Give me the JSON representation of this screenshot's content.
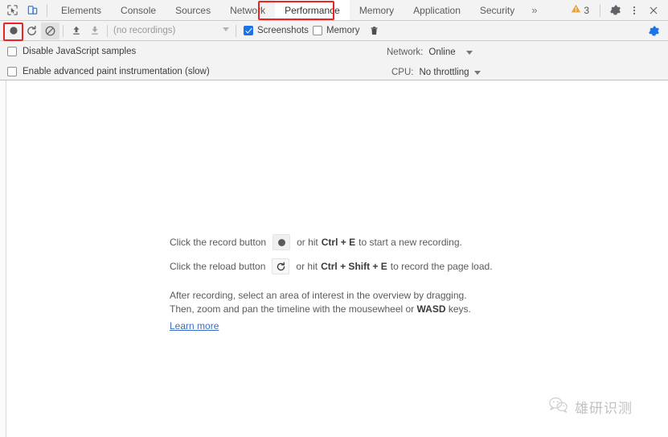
{
  "devtools": {
    "left_icons": [
      {
        "name": "inspect-element-icon",
        "title": "Inspect element"
      },
      {
        "name": "device-toolbar-icon",
        "title": "Toggle device toolbar"
      }
    ],
    "tabs": [
      {
        "label": "Elements",
        "selected": false
      },
      {
        "label": "Console",
        "selected": false
      },
      {
        "label": "Sources",
        "selected": false
      },
      {
        "label": "Network",
        "selected": false
      },
      {
        "label": "Performance",
        "selected": true
      },
      {
        "label": "Memory",
        "selected": false
      },
      {
        "label": "Application",
        "selected": false
      },
      {
        "label": "Security",
        "selected": false
      }
    ],
    "overflow_label": "»",
    "warnings": {
      "count": "3",
      "icon": "warning-triangle-icon",
      "color": "#e8a33d"
    },
    "right_icons": [
      {
        "name": "settings-gear-icon"
      },
      {
        "name": "more-options-kebab-icon"
      },
      {
        "name": "close-panel-icon"
      }
    ]
  },
  "toolbar": {
    "record_button": {
      "name": "record-button",
      "state": "idle"
    },
    "reload_button": {
      "name": "reload-and-record-button"
    },
    "clear_button": {
      "name": "clear-recording-button",
      "state": "pressed"
    },
    "load_button": {
      "name": "load-profile-icon"
    },
    "save_button": {
      "name": "save-profile-icon"
    },
    "recordings_value": "(no recordings)",
    "checkboxes": [
      {
        "label": "Screenshots",
        "checked": true,
        "name": "screenshots-checkbox"
      },
      {
        "label": "Memory",
        "checked": false,
        "name": "memory-checkbox"
      }
    ],
    "delete_button": {
      "name": "trash-icon"
    },
    "capture_settings_button": {
      "name": "capture-settings-gear-icon",
      "color": "#1a73e8"
    }
  },
  "settings": {
    "options": [
      {
        "label": "Disable JavaScript samples",
        "checked": false,
        "name": "disable-js-samples-checkbox"
      },
      {
        "label": "Enable advanced paint instrumentation (slow)",
        "checked": false,
        "name": "advanced-paint-instrumentation-checkbox"
      }
    ],
    "throttling": [
      {
        "label": "Network:",
        "value": "Online",
        "name": "network-throttling-select"
      },
      {
        "label": "CPU:",
        "value": "No throttling",
        "name": "cpu-throttling-select"
      }
    ]
  },
  "landing": {
    "line1_prefix": "Click the record button",
    "line1_mid": "or hit",
    "line1_kbd": "Ctrl + E",
    "line1_suffix": "to start a new recording.",
    "line2_prefix": "Click the reload button",
    "line2_mid": "or hit",
    "line2_kbd": "Ctrl + Shift + E",
    "line2_suffix": "to record the page load.",
    "para_line1": "After recording, select an area of interest in the overview by dragging.",
    "para_line2_prefix": "Then, zoom and pan the timeline with the mousewheel or",
    "para_line2_kbd": "WASD",
    "para_line2_suffix": "keys.",
    "learn_more": "Learn more"
  },
  "annotations": {
    "color": "#ee2222",
    "boxes": [
      {
        "name": "annotation-performance-tab",
        "target": "Performance"
      },
      {
        "name": "annotation-record-button",
        "target": "record-button"
      }
    ]
  },
  "watermark": {
    "text": "雄研识测",
    "icon": "wechat-logo-icon"
  }
}
